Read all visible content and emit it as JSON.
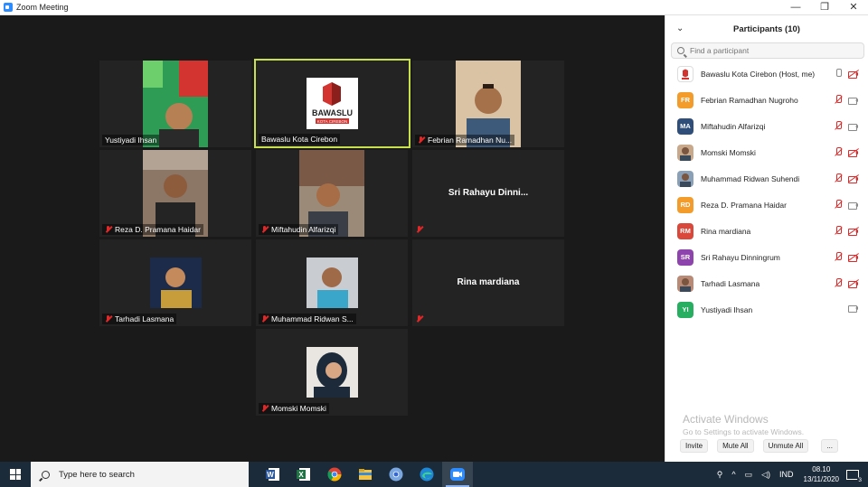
{
  "window": {
    "title": "Zoom Meeting",
    "minimize": "—",
    "restore": "❐",
    "close": "✕"
  },
  "tiles": [
    {
      "name": "Yustiyadi Ihsan",
      "muted": false
    },
    {
      "name": "Bawaslu Kota Cirebon",
      "muted": false,
      "logo_text": "BAWASLU",
      "logo_sub": "KOTA CIREBON"
    },
    {
      "name": "Febrian Ramadhan Nu...",
      "muted": true
    },
    {
      "name": "Reza D. Pramana Haidar",
      "muted": true
    },
    {
      "name": "Miftahudin Alfarizqi",
      "muted": true
    },
    {
      "name": "Sri Rahayu Dinni...",
      "muted": true
    },
    {
      "name": "Tarhadi Lasmana",
      "muted": true
    },
    {
      "name": "Muhammad Ridwan S...",
      "muted": true
    },
    {
      "name": "Rina mardiana",
      "muted": true
    },
    {
      "name": "Momski Momski",
      "muted": true
    }
  ],
  "participants": {
    "collapse_icon": "⌄",
    "title": "Participants (10)",
    "search_placeholder": "Find a participant",
    "list": [
      {
        "name": "Bawaslu Kota Cirebon (Host, me)",
        "initials": "",
        "color": "#ffffff",
        "mic_muted": false,
        "cam_off": true
      },
      {
        "name": "Febrian Ramadhan Nugroho",
        "initials": "FR",
        "color": "#f39c2b",
        "mic_muted": true,
        "cam_off": false
      },
      {
        "name": "Miftahudin Alfarizqi",
        "initials": "MA",
        "color": "#2f4f7a",
        "mic_muted": true,
        "cam_off": false
      },
      {
        "name": "Momski Momski",
        "initials": "",
        "color": "#c9a98c",
        "mic_muted": true,
        "cam_off": true
      },
      {
        "name": "Muhammad Ridwan Suhendi",
        "initials": "",
        "color": "#8aa0b6",
        "mic_muted": true,
        "cam_off": true
      },
      {
        "name": "Reza D. Pramana Haidar",
        "initials": "RD",
        "color": "#f39c2b",
        "mic_muted": true,
        "cam_off": false
      },
      {
        "name": "Rina mardiana",
        "initials": "RM",
        "color": "#d9483b",
        "mic_muted": true,
        "cam_off": true
      },
      {
        "name": "Sri Rahayu Dinningrum",
        "initials": "SR",
        "color": "#8e44ad",
        "mic_muted": true,
        "cam_off": true
      },
      {
        "name": "Tarhadi Lasmana",
        "initials": "",
        "color": "#b98a76",
        "mic_muted": true,
        "cam_off": true
      },
      {
        "name": "Yustiyadi Ihsan",
        "initials": "YI",
        "color": "#27ae60",
        "mic_muted": null,
        "cam_off": false
      }
    ],
    "footer": {
      "invite": "Invite",
      "mute_all": "Mute All",
      "unmute_all": "Unmute All",
      "more": "..."
    }
  },
  "watermark": {
    "line1": "Activate Windows",
    "line2": "Go to Settings to activate Windows."
  },
  "taskbar": {
    "search_placeholder": "Type here to search",
    "apps": [
      "word-icon",
      "excel-icon",
      "chrome-icon",
      "file-explorer-icon",
      "chrome-dev-icon",
      "edge-icon",
      "zoom-icon"
    ],
    "tray_chevron": "^",
    "language": "IND",
    "time": "08.10",
    "date": "13/11/2020",
    "notifications": "3"
  }
}
